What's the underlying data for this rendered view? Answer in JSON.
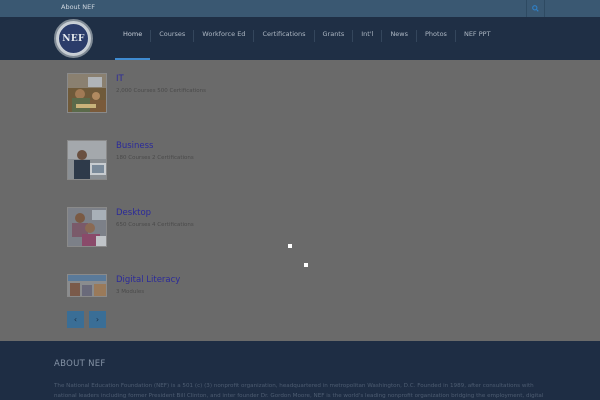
{
  "topbar": {
    "about_link": "About NEF",
    "search_icon": "search-icon"
  },
  "header": {
    "logo_text": "NEF"
  },
  "nav": {
    "items": [
      "Home",
      "Courses",
      "Workforce Ed",
      "Certifications",
      "Grants",
      "Int'l",
      "News",
      "Photos",
      "NEF PPT"
    ],
    "active": "Home"
  },
  "courses": [
    {
      "title": "IT",
      "meta": "2,000 Courses 500 Certifications"
    },
    {
      "title": "Business",
      "meta": "180 Courses 2 Certifications"
    },
    {
      "title": "Desktop",
      "meta": "650 Courses 4 Certifications"
    },
    {
      "title": "Digital Literacy",
      "meta": "3 Modules"
    }
  ],
  "pager": {
    "prev": "‹",
    "next": "›"
  },
  "footer": {
    "title": "ABOUT NEF",
    "text": "The National Education Foundation (NEF) is a 501 (c) (3) nonprofit organization, headquartered in metropolitan Washington, D.C. Founded in 1989, after consultations with national leaders including former President Bill Clinton, and inter founder Dr. Gordon Moore, NEF is the world's leading nonprofit organization bridging the employment, digital"
  },
  "colors": {
    "accent": "#3f8bd0",
    "nav_bg": "#1f2f45",
    "topbar_bg": "#3a5872",
    "overlay_bg": "#6a6a6a",
    "link": "#2b2a9a"
  }
}
